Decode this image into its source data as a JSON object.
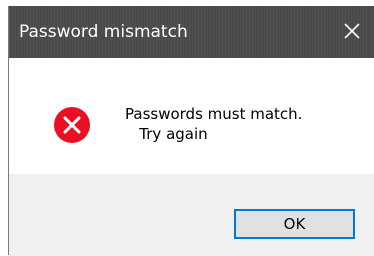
{
  "dialog": {
    "title": "Password mismatch",
    "icon": "error-x-icon",
    "message": "Passwords must match.\n   Try again",
    "buttons": {
      "ok_label": "OK"
    }
  },
  "colors": {
    "titlebar": "#4a4a4a",
    "error_icon": "#e81123",
    "ok_border": "#0078d7"
  }
}
